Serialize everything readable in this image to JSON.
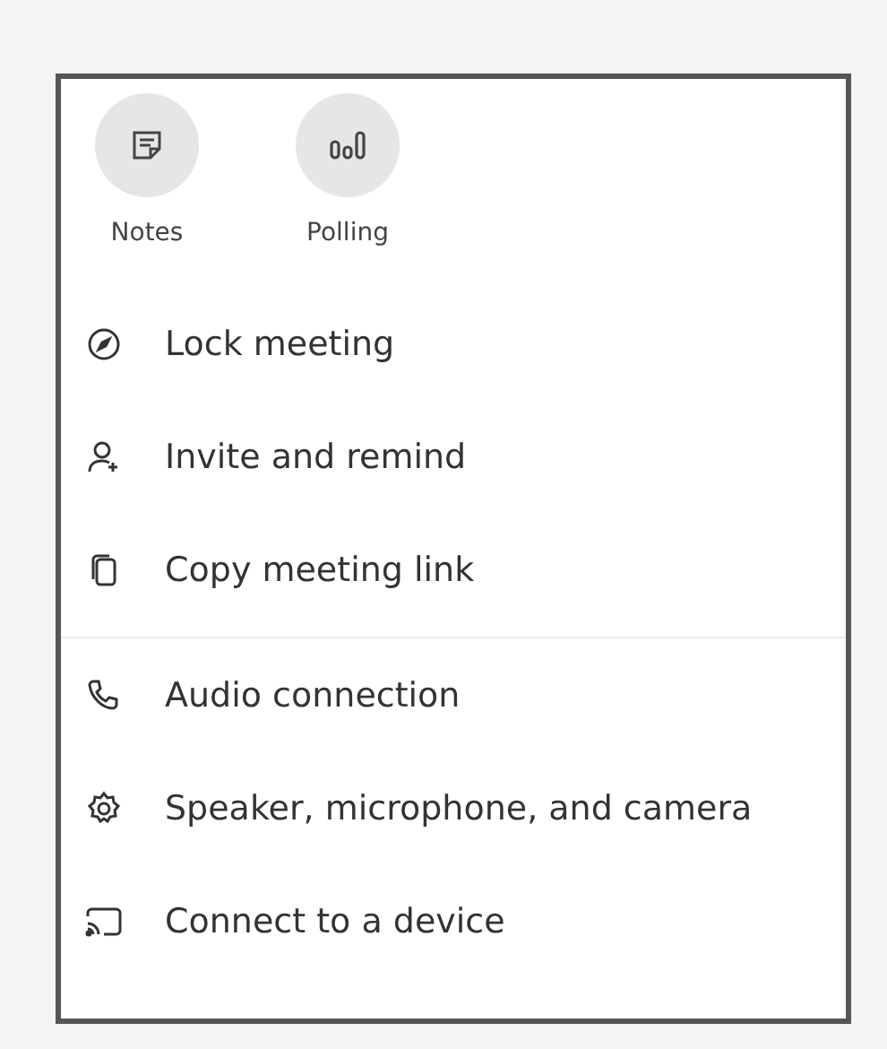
{
  "apps": [
    {
      "label": "Notes"
    },
    {
      "label": "Polling"
    }
  ],
  "sections": [
    {
      "items": [
        {
          "label": "Lock meeting"
        },
        {
          "label": "Invite and remind"
        },
        {
          "label": "Copy meeting link"
        }
      ]
    },
    {
      "items": [
        {
          "label": "Audio connection"
        },
        {
          "label": "Speaker, microphone, and camera"
        },
        {
          "label": "Connect to a device"
        }
      ]
    }
  ]
}
